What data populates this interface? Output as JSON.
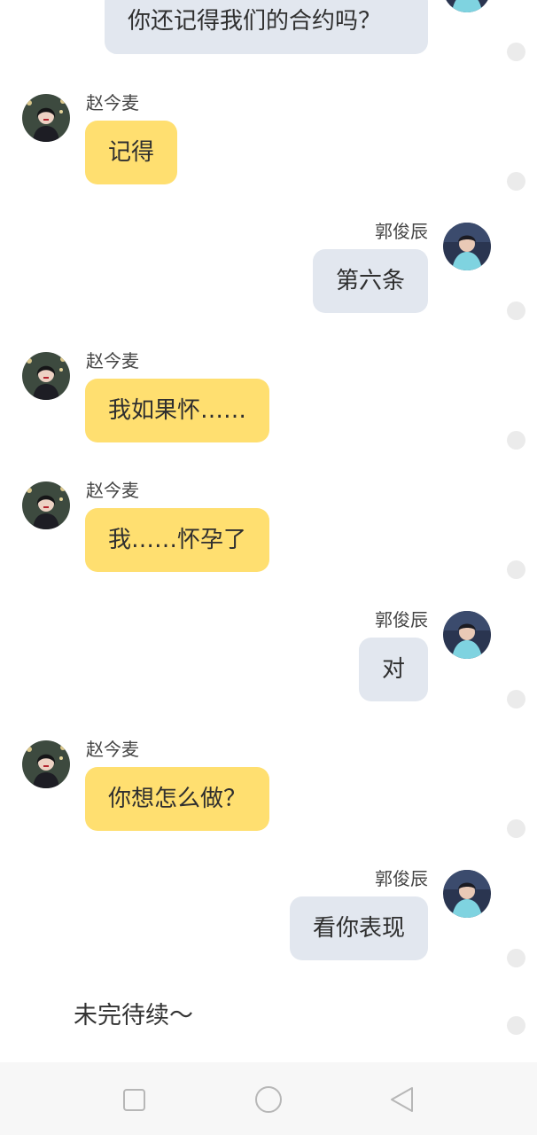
{
  "colors": {
    "left_bubble": "#ffdf70",
    "right_bubble": "#e2e7ef",
    "dot": "#ebebeb",
    "nav_bg": "#f7f7f7"
  },
  "previous_message": {
    "text": "你还记得我们的合约吗？",
    "avatar_icon": "male-avatar"
  },
  "messages": [
    {
      "side": "left",
      "sender": "赵今麦",
      "text": "记得",
      "avatar_icon": "female-avatar"
    },
    {
      "side": "right",
      "sender": "郭俊辰",
      "text": "第六条",
      "avatar_icon": "male-avatar"
    },
    {
      "side": "left",
      "sender": "赵今麦",
      "text": "我如果怀……",
      "avatar_icon": "female-avatar"
    },
    {
      "side": "left",
      "sender": "赵今麦",
      "text": "我……怀孕了",
      "avatar_icon": "female-avatar"
    },
    {
      "side": "right",
      "sender": "郭俊辰",
      "text": "对",
      "avatar_icon": "male-avatar"
    },
    {
      "side": "left",
      "sender": "赵今麦",
      "text": "你想怎么做？",
      "avatar_icon": "female-avatar"
    },
    {
      "side": "right",
      "sender": "郭俊辰",
      "text": "看你表现",
      "avatar_icon": "male-avatar"
    }
  ],
  "footer_text": "未完待续～",
  "nav": {
    "recent_icon": "square-icon",
    "home_icon": "circle-icon",
    "back_icon": "triangle-back-icon"
  }
}
